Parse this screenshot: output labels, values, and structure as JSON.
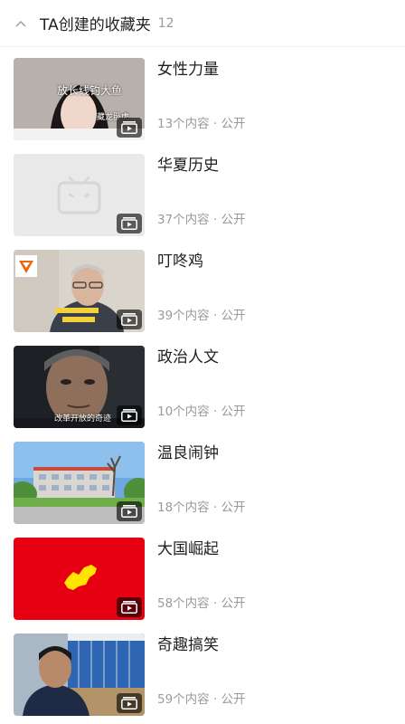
{
  "header": {
    "title": "TA创建的收藏夹",
    "count": "12"
  },
  "folders": [
    {
      "title": "女性力量",
      "meta": "13个内容 · 公开",
      "thumb_text": "放长线钓大鱼",
      "thumb_text2": "藏龙卧虎"
    },
    {
      "title": "华夏历史",
      "meta": "37个内容 · 公开"
    },
    {
      "title": "叮咚鸡",
      "meta": "39个内容 · 公开"
    },
    {
      "title": "政治人文",
      "meta": "10个内容 · 公开",
      "thumb_text": "改革开放的奇迹"
    },
    {
      "title": "温良闹钟",
      "meta": "18个内容 · 公开"
    },
    {
      "title": "大国崛起",
      "meta": "58个内容 · 公开"
    },
    {
      "title": "奇趣搞笑",
      "meta": "59个内容 · 公开"
    }
  ],
  "colors": {
    "text": "#1f1f1f",
    "muted": "#9a9a9a",
    "red": "#e60012",
    "yellow": "#ffe400"
  },
  "icons": {
    "collapse": "chevron-up-icon",
    "play": "playlist-play-icon",
    "placeholder": "tv-placeholder-icon"
  }
}
